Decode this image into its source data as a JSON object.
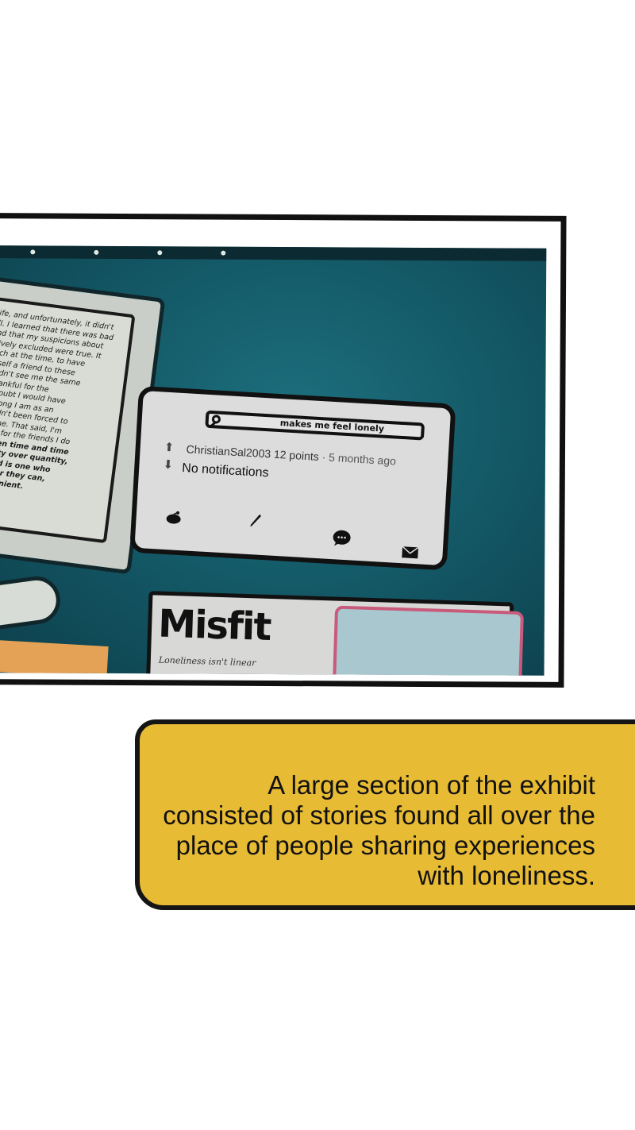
{
  "photo": {
    "story_lines": [
      "ife, and unfortunately, it didn't",
      "ll. I learned that there was bad",
      "nd that my suspicions about",
      "tively excluded were true. It",
      "uch at the time, to have",
      "yself a friend to these",
      "didn't see me the same",
      "thankful for the",
      "l doubt I would have",
      "strong I am as an",
      "hadn't been forced to",
      "alone. That said, I'm",
      "kful for the friends I do"
    ],
    "story_bold_lines": [
      "roven time and time",
      "uality over quantity,",
      "riend is one who",
      "never they can,",
      "onvenient."
    ],
    "search_text": "makes me feel lonely",
    "username": "ChristianSal2003",
    "points": "12 points",
    "separator": "·",
    "time_ago": "5 months ago",
    "notification_text": "No notifications",
    "misfit_title": "Misfit",
    "misfit_subtitle": "Loneliness isn't linear"
  },
  "caption": {
    "text": "A large section of the exhibit consisted of stories found all over the place of people sharing experiences with loneliness."
  },
  "colors": {
    "caption_bg": "#e8bb35",
    "wall": "#1d6f7e",
    "frame": "#111111"
  },
  "icons": [
    "search-icon",
    "upvote-icon",
    "downvote-icon",
    "reddit-icon",
    "pencil-icon",
    "chat-icon",
    "mail-icon"
  ]
}
